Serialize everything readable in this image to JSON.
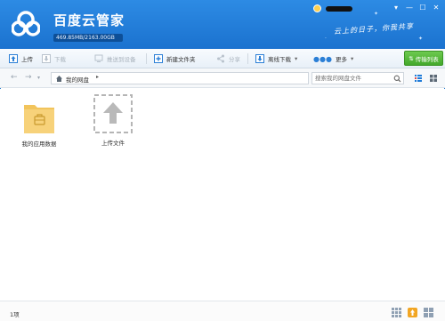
{
  "header": {
    "app_title": "百度云管家",
    "quota": "469.85MB/2163.00GB",
    "slogan": "云上的日子，你我共享",
    "window_controls": [
      "▾",
      "—",
      "☐",
      "✕"
    ]
  },
  "toolbar": {
    "items": [
      {
        "label": "上传",
        "icon": "upload-icon",
        "enabled": true
      },
      {
        "label": "下载",
        "icon": "download-icon",
        "enabled": false
      },
      {
        "label": "推送到设备",
        "icon": "push-to-device-icon",
        "enabled": false
      },
      {
        "label": "新建文件夹",
        "icon": "new-folder-icon",
        "enabled": true
      },
      {
        "label": "分享",
        "icon": "share-icon",
        "enabled": false
      },
      {
        "label": "离线下载",
        "icon": "offline-download-icon",
        "enabled": true
      },
      {
        "label": "更多",
        "icon": "more-icon",
        "enabled": true
      }
    ],
    "transfer_label": "传输列表"
  },
  "addressbar": {
    "path": "我的网盘",
    "search_placeholder": "搜索我的网盘文件"
  },
  "files": [
    {
      "name": "我的应用数据",
      "icon": "folder-icon"
    },
    {
      "name": "上传文件",
      "icon": "upload-placeholder-icon"
    }
  ],
  "status": {
    "count": "1项"
  },
  "colors": {
    "header_blue": "#1f7bd8",
    "folder_yellow": "#f6cf72",
    "transfer_green": "#4caf32"
  }
}
